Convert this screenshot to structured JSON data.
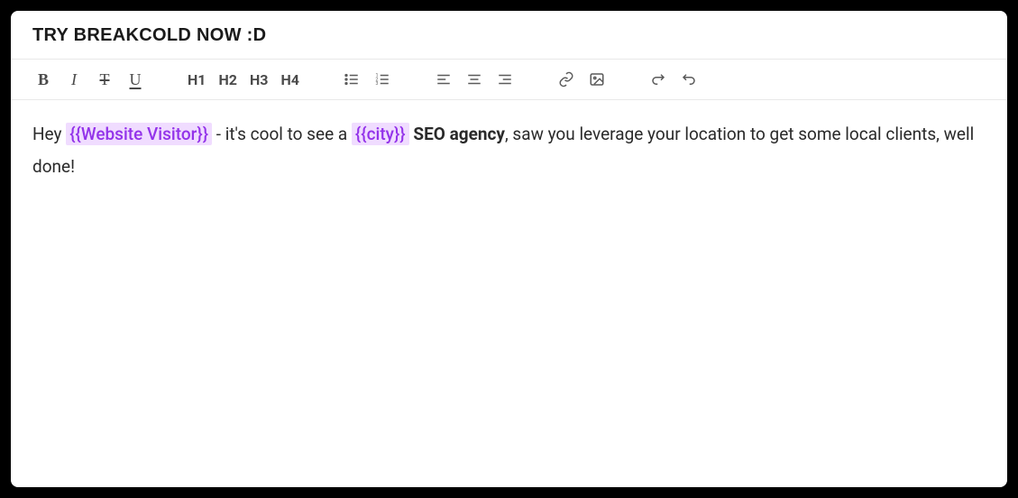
{
  "title": "TRY BREAKCOLD NOW :D",
  "toolbar": {
    "headings": [
      "H1",
      "H2",
      "H3",
      "H4"
    ]
  },
  "body": {
    "seg1": "Hey ",
    "token1": "{{Website Visitor}}",
    "seg2": " - it's cool to see a ",
    "token2": "{{city}}",
    "seg3": " ",
    "bold": "SEO agency",
    "seg4": ", saw you leverage your location to get some local clients, well done!"
  }
}
